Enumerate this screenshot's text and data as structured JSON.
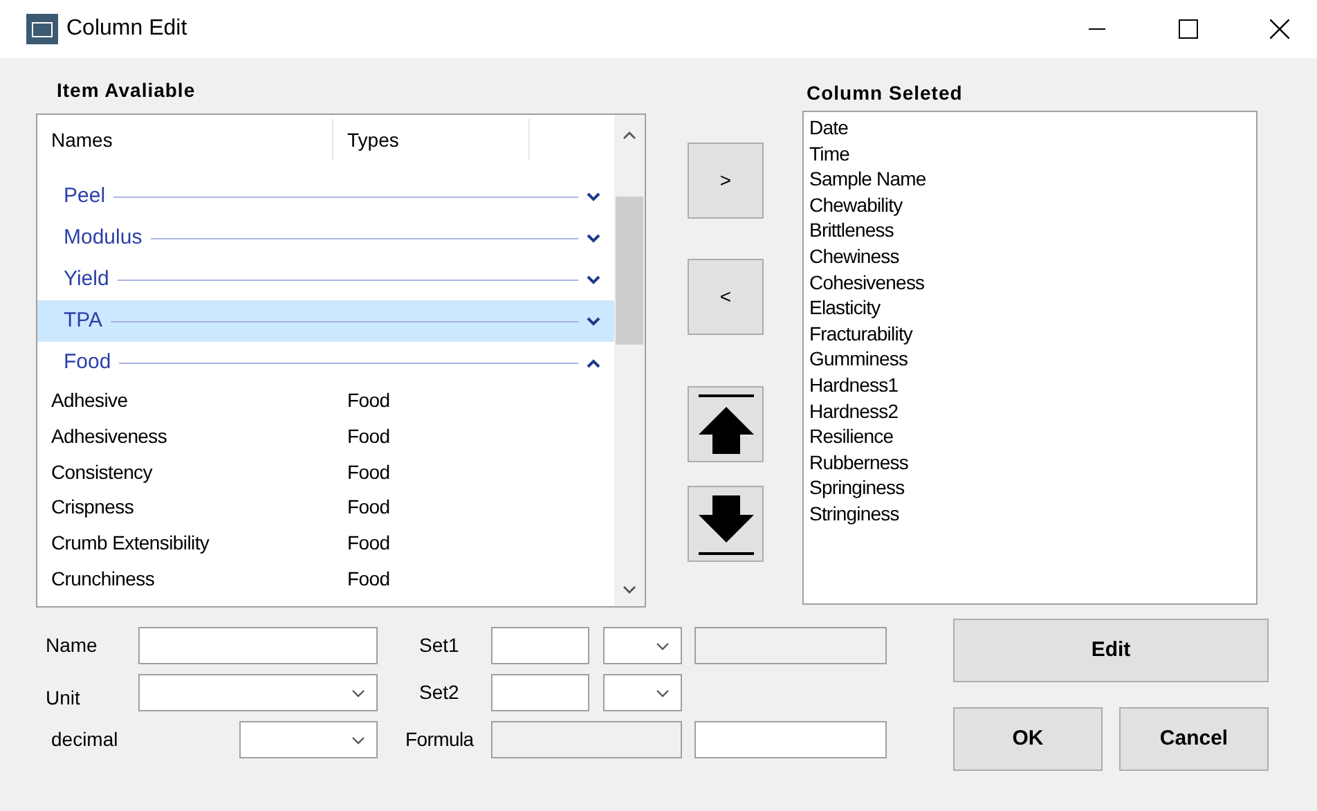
{
  "window": {
    "title": "Column Edit"
  },
  "available": {
    "heading": "Item Avaliable",
    "columns": [
      "Names",
      "Types"
    ],
    "rows": [
      {
        "kind": "group",
        "label": "Peel",
        "expanded": false,
        "selected": false
      },
      {
        "kind": "group",
        "label": "Modulus",
        "expanded": false,
        "selected": false
      },
      {
        "kind": "group",
        "label": "Yield",
        "expanded": false,
        "selected": false
      },
      {
        "kind": "group",
        "label": "TPA",
        "expanded": false,
        "selected": true
      },
      {
        "kind": "group",
        "label": "Food",
        "expanded": true,
        "selected": false
      },
      {
        "kind": "item",
        "name": "Adhesive",
        "type": "Food",
        "selected": false
      },
      {
        "kind": "item",
        "name": "Adhesiveness",
        "type": "Food",
        "selected": false
      },
      {
        "kind": "item",
        "name": "Consistency",
        "type": "Food",
        "selected": false
      },
      {
        "kind": "item",
        "name": "Crispness",
        "type": "Food",
        "selected": false
      },
      {
        "kind": "item",
        "name": "Crumb Extensibility",
        "type": "Food",
        "selected": false
      },
      {
        "kind": "item",
        "name": "Crunchiness",
        "type": "Food",
        "selected": false
      }
    ]
  },
  "move_buttons": [
    {
      "kind": "text",
      "label": ">"
    },
    {
      "kind": "text",
      "label": "<"
    },
    {
      "kind": "up"
    },
    {
      "kind": "down"
    }
  ],
  "selected_columns": {
    "heading": "Column Seleted",
    "items": [
      "Date",
      "Time",
      "Sample Name",
      "Chewability",
      "Brittleness",
      "Chewiness",
      "Cohesiveness",
      "Elasticity",
      "Fracturability",
      "Gumminess",
      "Hardness1",
      "Hardness2",
      "Resilience",
      "Rubberness",
      "Springiness",
      "Stringiness"
    ]
  },
  "form": {
    "name_label": "Name",
    "unit_label": "Unit",
    "decimal_label": "decimal",
    "set1_label": "Set1",
    "set2_label": "Set2",
    "formula_label": "Formula"
  },
  "buttons": {
    "edit": "Edit",
    "ok": "OK",
    "cancel": "Cancel"
  }
}
